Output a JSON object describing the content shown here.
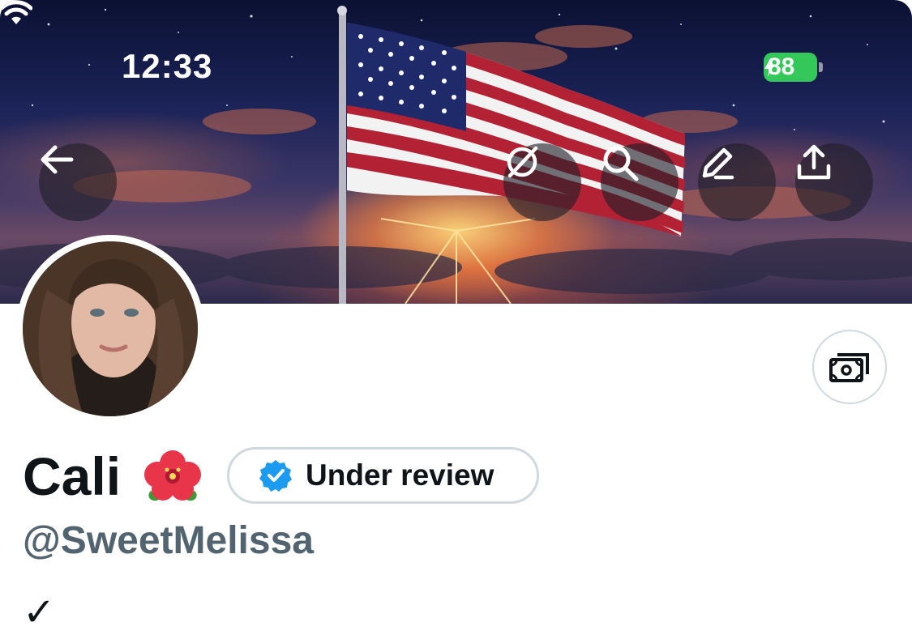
{
  "status_bar": {
    "time": "12:33",
    "battery_level": "88",
    "battery_color": "#34c759"
  },
  "header_actions": {
    "back_icon": "arrow-left-icon",
    "grok_icon": "grok-icon",
    "search_icon": "search-icon",
    "edit_icon": "pencil-icon",
    "share_icon": "share-upload-icon"
  },
  "profile": {
    "display_name": "Cali",
    "name_emoji": "hibiscus-emoji",
    "verification_label": "Under review",
    "verification_color": "#1d9bf0",
    "handle": "@SweetMelissa",
    "tip_icon": "money-icon",
    "bio_partial": "✓ "
  },
  "colors": {
    "text_primary": "#0f1419",
    "text_secondary": "#536471",
    "border": "#cfd9de"
  }
}
